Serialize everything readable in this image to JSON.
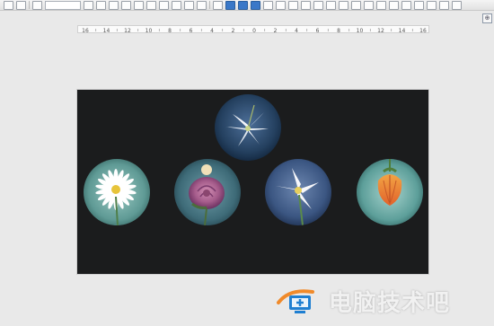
{
  "toolbar": {
    "font_size_value": "",
    "icons": [
      "cursor-icon",
      "text-icon",
      "font-size-field",
      "font-color-icon",
      "font-icon",
      "bold-icon",
      "align-icon",
      "table-icon",
      "shape-icon",
      "chart-icon",
      "picture-icon",
      "symbol-icon"
    ]
  },
  "ruler": {
    "ticks": [
      "16",
      "14",
      "12",
      "10",
      "8",
      "6",
      "4",
      "2",
      "0",
      "2",
      "4",
      "6",
      "8",
      "10",
      "12",
      "14",
      "16"
    ]
  },
  "slide": {
    "background": "#1b1c1d",
    "images": [
      {
        "name": "lily-image",
        "subject": "white lily"
      },
      {
        "name": "daisy-image",
        "subject": "white daisy"
      },
      {
        "name": "rose-image",
        "subject": "pink rose"
      },
      {
        "name": "narcissus-image",
        "subject": "white narcissus"
      },
      {
        "name": "tulip-image",
        "subject": "orange tulip bud"
      }
    ]
  },
  "watermark": {
    "text": "电脑技术吧",
    "icon": "computer-logo-icon"
  }
}
